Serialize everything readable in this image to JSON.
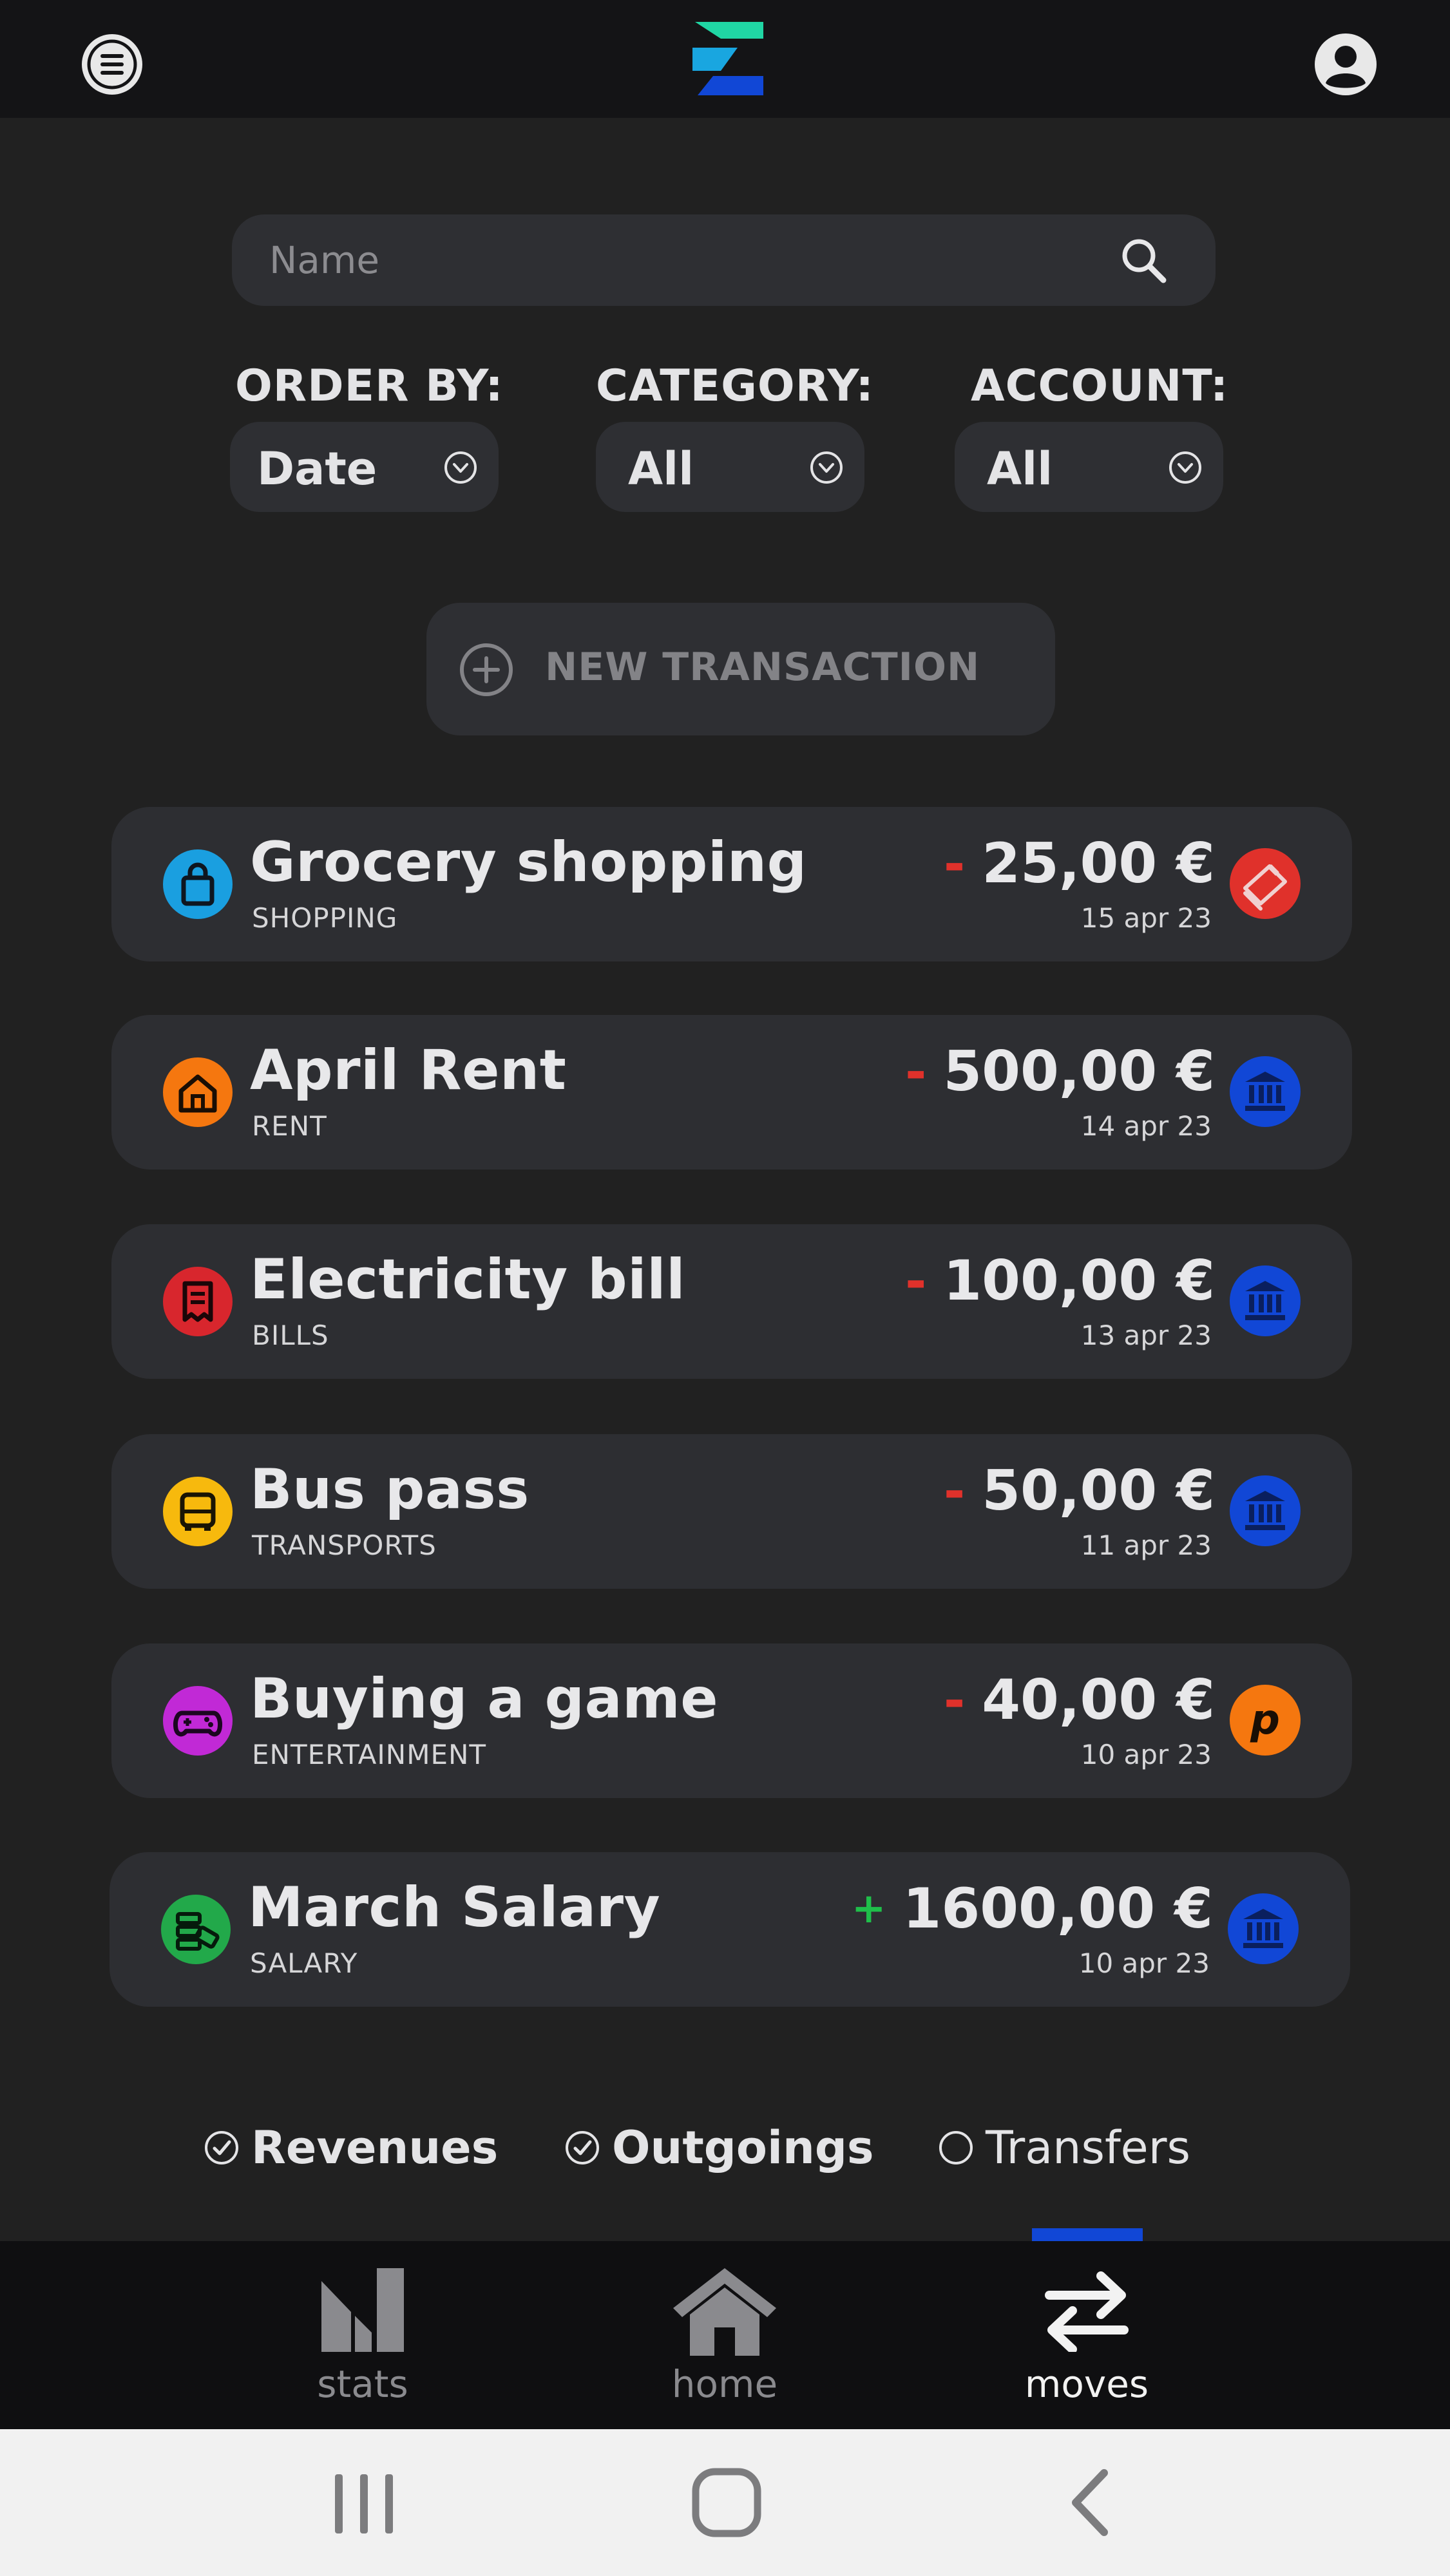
{
  "search": {
    "placeholder": "Name"
  },
  "filters": [
    {
      "label": "ORDER BY:",
      "value": "Date"
    },
    {
      "label": "CATEGORY:",
      "value": "All"
    },
    {
      "label": "ACCOUNT:",
      "value": "All"
    }
  ],
  "new_transaction": {
    "label": "NEW TRANSACTION"
  },
  "transactions": [
    {
      "title": "Grocery shopping",
      "category": "SHOPPING",
      "sign": "-",
      "amount": "25,00 €",
      "date": "15 apr 23",
      "category_icon": "shopping-bag-icon",
      "category_color": "#1a9fe0",
      "account_icon": "card-icon",
      "account_color": "#e0312b"
    },
    {
      "title": "April Rent",
      "category": "RENT",
      "sign": "-",
      "amount": "500,00 €",
      "date": "14 apr 23",
      "category_icon": "house-icon",
      "category_color": "#f5770f",
      "account_icon": "bank-icon",
      "account_color": "#1147d6"
    },
    {
      "title": "Electricity bill",
      "category": "BILLS",
      "sign": "-",
      "amount": "100,00 €",
      "date": "13 apr 23",
      "category_icon": "receipt-icon",
      "category_color": "#d8262d",
      "account_icon": "bank-icon",
      "account_color": "#1147d6"
    },
    {
      "title": "Bus pass",
      "category": "TRANSPORTS",
      "sign": "-",
      "amount": "50,00 €",
      "date": "11 apr 23",
      "category_icon": "bus-icon",
      "category_color": "#f7b90d",
      "account_icon": "bank-icon",
      "account_color": "#1147d6"
    },
    {
      "title": "Buying a game",
      "category": "ENTERTAINMENT",
      "sign": "-",
      "amount": "40,00 €",
      "date": "10 apr 23",
      "category_icon": "gamepad-icon",
      "category_color": "#c129d6",
      "account_icon": "paypal-icon",
      "account_glyph": "p",
      "account_color": "#f5770f"
    },
    {
      "title": "March Salary",
      "category": "SALARY",
      "sign": "+",
      "amount": "1600,00 €",
      "date": "10 apr 23",
      "category_icon": "cash-icon",
      "category_color": "#22a94a",
      "account_icon": "bank-icon",
      "account_color": "#1147d6"
    }
  ],
  "type_filters": [
    {
      "label": "Revenues",
      "checked": true
    },
    {
      "label": "Outgoings",
      "checked": true
    },
    {
      "label": "Transfers",
      "checked": false
    }
  ],
  "bottom_nav": [
    {
      "label": "stats",
      "icon": "stats-icon",
      "active": false
    },
    {
      "label": "home",
      "icon": "home-icon",
      "active": false
    },
    {
      "label": "moves",
      "icon": "transfer-arrows-icon",
      "active": true
    }
  ],
  "colors": {
    "accent": "#1147d6",
    "negative": "#e0312b",
    "positive": "#1fbf4a",
    "background": "#212121",
    "card": "#2d2e32"
  }
}
